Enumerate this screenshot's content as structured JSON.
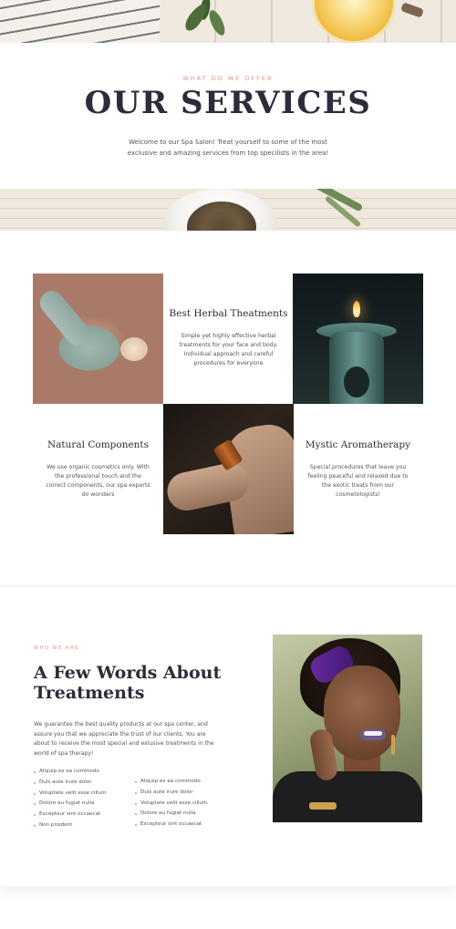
{
  "services": {
    "eyebrow": "WHAT DO WE OFFER",
    "title": "OUR SERVICES",
    "intro": "Welcome to our Spa Salon! Treat yourself to some of the most exclusive and amazing services from top specilists in the area!"
  },
  "cards": [
    {
      "title": "Best Herbal Theatments",
      "description": "Simple yet highly effective herbal treatments for your face and body. Individual approach and careful procedures for everyone"
    },
    {
      "title": "Natural Components",
      "description": "We use organic cosmetics only. With the professional touch and the correct components, our spa experts do wonders"
    },
    {
      "title": "Mystic Aromatherapy",
      "description": "Special procedures that leave you feeling peaceful and relaxed due to the exotic treats from our cosmetologists!"
    }
  ],
  "about": {
    "eyebrow": "WHO WE ARE",
    "title": "A Few Words About Treatments",
    "text": "We guarantee the best quality products at our spa center, and assure you that we appreciate the trust of our clients. You are about to receive the most special and exlusive treatments in the world of spa therapy!",
    "list_left": [
      "Aliquip ex ea commodo",
      "Duis aute irure dolor",
      "Voluptate velit esse cillum",
      "Dolore eu fugiat nulla",
      "Excepteur sint occaecat",
      "Non proident"
    ],
    "list_right": [
      "Aliquip ex ea commodo",
      "Duis aute irure dolor",
      "Voluptate velit esse cillum",
      "Dolore eu fugiat nulla",
      "Excepteur sint occaecat"
    ]
  },
  "colors": {
    "accent": "#e2918a",
    "heading": "#2c2c3a",
    "body_text": "#555555"
  }
}
